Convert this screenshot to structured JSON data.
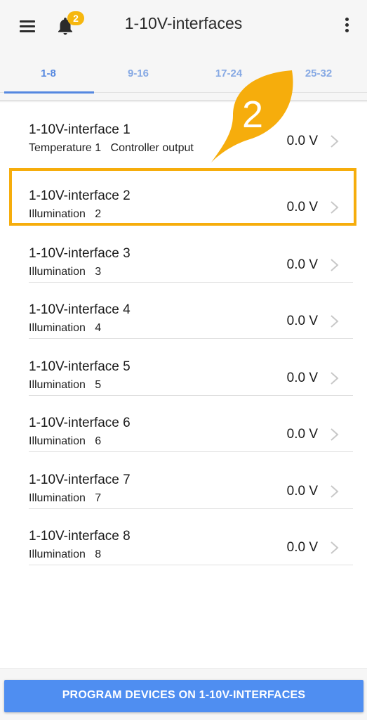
{
  "header": {
    "title": "1-10V-interfaces",
    "notification_count": "2",
    "menu_icon": "hamburger-menu-icon",
    "bell_icon": "bell-icon",
    "more_icon": "more-vert-icon"
  },
  "tabs": [
    {
      "label": "1-8",
      "active": true
    },
    {
      "label": "9-16",
      "active": false
    },
    {
      "label": "17-24",
      "active": false
    },
    {
      "label": "25-32",
      "active": false
    }
  ],
  "items": [
    {
      "name": "1-10V-interface 1",
      "type": "Temperature 1",
      "detail": "Controller output",
      "value": "0.0 V"
    },
    {
      "name": "1-10V-interface 2",
      "type": "Illumination",
      "detail": "2",
      "value": "0.0 V"
    },
    {
      "name": "1-10V-interface 3",
      "type": "Illumination",
      "detail": "3",
      "value": "0.0 V"
    },
    {
      "name": "1-10V-interface 4",
      "type": "Illumination",
      "detail": "4",
      "value": "0.0 V"
    },
    {
      "name": "1-10V-interface 5",
      "type": "Illumination",
      "detail": "5",
      "value": "0.0 V"
    },
    {
      "name": "1-10V-interface 6",
      "type": "Illumination",
      "detail": "6",
      "value": "0.0 V"
    },
    {
      "name": "1-10V-interface 7",
      "type": "Illumination",
      "detail": "7",
      "value": "0.0 V"
    },
    {
      "name": "1-10V-interface 8",
      "type": "Illumination",
      "detail": "8",
      "value": "0.0 V"
    }
  ],
  "annotation": {
    "number": "2",
    "color": "#f6ad0c"
  },
  "footer": {
    "program_button_label": "PROGRAM DEVICES ON 1-10V-INTERFACES"
  },
  "colors": {
    "accent": "#5588e0",
    "badge": "#f6b70f",
    "button": "#4f8ef1"
  }
}
